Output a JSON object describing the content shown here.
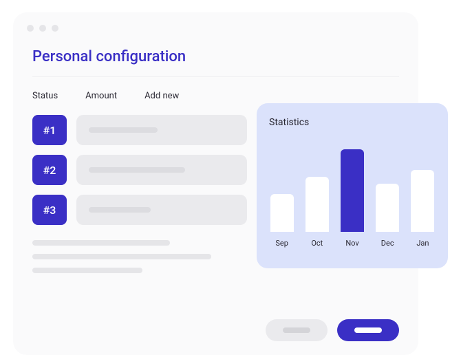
{
  "header": {
    "title": "Personal configuration"
  },
  "tabs": {
    "items": [
      {
        "label": "Status"
      },
      {
        "label": "Amount"
      },
      {
        "label": "Add new"
      }
    ]
  },
  "rows": {
    "items": [
      {
        "badge": "#1"
      },
      {
        "badge": "#2"
      },
      {
        "badge": "#3"
      }
    ]
  },
  "stats": {
    "title": "Statistics"
  },
  "chart_data": {
    "type": "bar",
    "categories": [
      "Sep",
      "Oct",
      "Nov",
      "Dec",
      "Jan"
    ],
    "values": [
      55,
      80,
      120,
      70,
      90
    ],
    "highlight_index": 2,
    "title": "Statistics",
    "xlabel": "",
    "ylabel": "",
    "ylim": [
      0,
      140
    ]
  },
  "colors": {
    "primary": "#3a2fc5",
    "card": "#dbe2fb",
    "surface": "#fafafb",
    "muted": "#eaeaed"
  }
}
